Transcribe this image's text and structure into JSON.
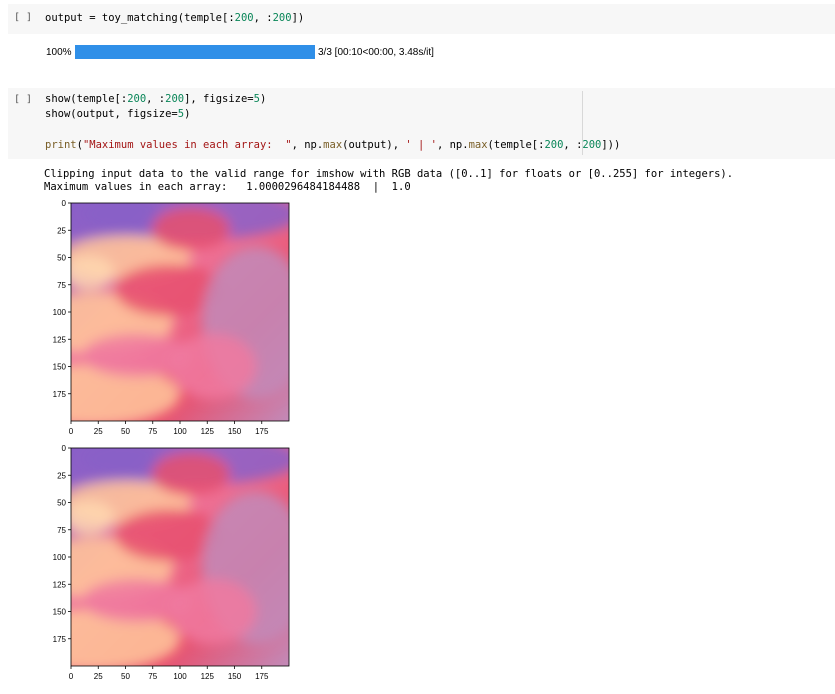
{
  "cell1": {
    "prompt": "[ ]",
    "code": [
      {
        "t": "output = toy_matching(temple[:",
        "c": ""
      },
      {
        "t": "200",
        "c": "num"
      },
      {
        "t": ", :",
        "c": ""
      },
      {
        "t": "200",
        "c": "num"
      },
      {
        "t": "])",
        "c": ""
      }
    ]
  },
  "progress": {
    "percent_label": "100%",
    "fraction": 1.0,
    "status": "3/3 [00:10<00:00, 3.48s/it]",
    "bar_color": "#2f8fe8"
  },
  "cell2": {
    "prompt": "[ ]",
    "line1": [
      {
        "t": "show(temple[:",
        "c": ""
      },
      {
        "t": "200",
        "c": "num"
      },
      {
        "t": ", :",
        "c": ""
      },
      {
        "t": "200",
        "c": "num"
      },
      {
        "t": "], figsize=",
        "c": ""
      },
      {
        "t": "5",
        "c": "num"
      },
      {
        "t": ")",
        "c": ""
      }
    ],
    "line2": [
      {
        "t": "show(output, figsize=",
        "c": ""
      },
      {
        "t": "5",
        "c": "num"
      },
      {
        "t": ")",
        "c": ""
      }
    ],
    "line3": [
      {
        "t": "print",
        "c": "fn"
      },
      {
        "t": "(",
        "c": ""
      },
      {
        "t": "\"Maximum values in each array:  \"",
        "c": "str"
      },
      {
        "t": ", np.",
        "c": ""
      },
      {
        "t": "max",
        "c": "fn"
      },
      {
        "t": "(output), ",
        "c": ""
      },
      {
        "t": "' | '",
        "c": "str"
      },
      {
        "t": ", np.",
        "c": ""
      },
      {
        "t": "max",
        "c": "fn"
      },
      {
        "t": "(temple[:",
        "c": ""
      },
      {
        "t": "200",
        "c": "num"
      },
      {
        "t": ", :",
        "c": ""
      },
      {
        "t": "200",
        "c": "num"
      },
      {
        "t": "]))",
        "c": ""
      }
    ]
  },
  "output_text": {
    "line1": "Clipping input data to the valid range for imshow with RGB data ([0..1] for floats or [0..255] for integers).",
    "line2": "Maximum values in each array:   1.0000296484184488  |  1.0"
  },
  "plots": [
    {
      "name": "temple-plot",
      "y_ticks": [
        "0",
        "25",
        "50",
        "75",
        "100",
        "125",
        "150",
        "175"
      ],
      "x_ticks": [
        "0",
        "25",
        "50",
        "75",
        "100",
        "125",
        "150",
        "175"
      ],
      "xlim": [
        0,
        200
      ],
      "ylim": [
        0,
        200
      ]
    },
    {
      "name": "output-plot",
      "y_ticks": [
        "0",
        "25",
        "50",
        "75",
        "100",
        "125",
        "150",
        "175"
      ],
      "x_ticks": [
        "0",
        "25",
        "50",
        "75",
        "100",
        "125",
        "150",
        "175"
      ],
      "xlim": [
        0,
        200
      ],
      "ylim": [
        0,
        200
      ]
    }
  ],
  "colors": {
    "sky_purple": "#8a5fc8",
    "cloud_pink": "#f07aa0",
    "cloud_peach": "#ffc79a",
    "cloud_red": "#e8506e",
    "haze_mauve": "#c28ab8"
  }
}
